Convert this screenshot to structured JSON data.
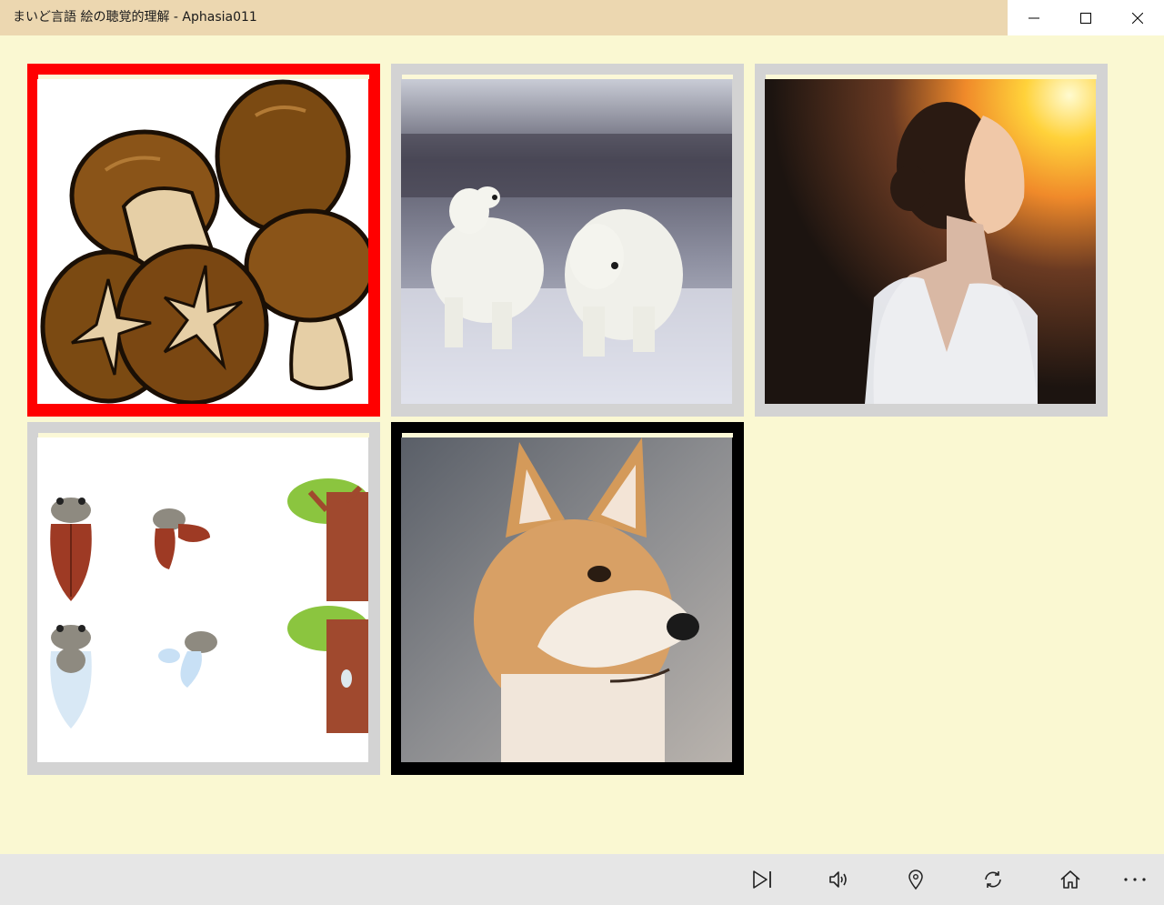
{
  "window": {
    "title": "まいど言語 絵の聴覚的理解 - Aphasia011"
  },
  "icons": {
    "minimize": "minimize-icon",
    "maximize": "maximize-icon",
    "close": "close-icon",
    "skip": "skip-next-icon",
    "volume": "volume-icon",
    "location": "map-pin-icon",
    "refresh": "refresh-icon",
    "home": "home-icon",
    "more": "more-icon"
  },
  "cards": [
    {
      "subject": "mushrooms",
      "state": "selected"
    },
    {
      "subject": "polar-bears",
      "state": "normal"
    },
    {
      "subject": "woman",
      "state": "normal"
    },
    {
      "subject": "cicadas",
      "state": "normal"
    },
    {
      "subject": "shiba-dog",
      "state": "current"
    }
  ],
  "colors": {
    "background": "#faf8d2",
    "titlebar": "#ecd7b0",
    "selected_border": "#ff0000",
    "current_border": "#000000",
    "normal_border": "#d3d3d3",
    "appbar": "#e6e6e6"
  }
}
